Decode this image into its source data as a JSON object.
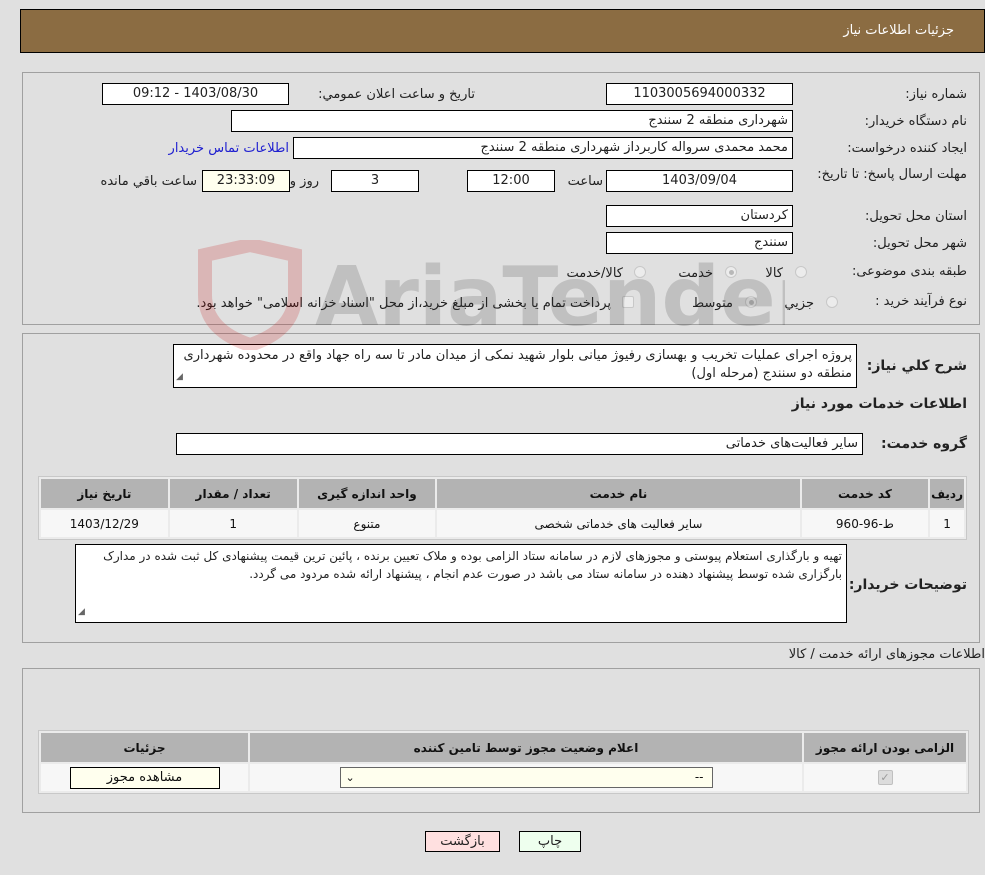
{
  "header": {
    "title": "جزئیات اطلاعات نیاز"
  },
  "form": {
    "need_number": {
      "label": "شماره نیاز:",
      "value": "1103005694000332"
    },
    "announce_datetime": {
      "label": "تاريخ و ساعت اعلان عمومي:",
      "value": "1403/08/30 - 09:12"
    },
    "buyer_org": {
      "label": "نام دستگاه خريدار:",
      "value": "شهرداری منطقه 2 سنندج"
    },
    "requester": {
      "label": "ايجاد کننده درخواست:",
      "value": "محمد محمدی سرواله کاربرداز شهرداری منطقه 2 سنندج"
    },
    "buyer_contact_link": "اطلاعات تماس خريدار",
    "deadline": {
      "label": "مهلت ارسال پاسخ: تا تاريخ:",
      "date": "1403/09/04",
      "time_label": "ساعت",
      "time": "12:00",
      "days": "3",
      "days_label": "روز و",
      "remaining": "23:33:09",
      "remaining_label": "ساعت باقي مانده"
    },
    "province": {
      "label": "استان محل تحويل:",
      "value": "کردستان"
    },
    "city": {
      "label": "شهر محل تحويل:",
      "value": "سنندج"
    },
    "category": {
      "label": "طبقه بندی موضوعی:",
      "options": [
        "کالا",
        "خدمت",
        "کالا/خدمت"
      ],
      "selected": "خدمت"
    },
    "purchase_type": {
      "label": "نوع فرآيند خريد :",
      "options": [
        "جزيي",
        "متوسط"
      ],
      "selected": "متوسط",
      "treasury_note": "پرداخت تمام يا بخشی از مبلغ خريد،از محل \"اسناد خزانه اسلامی\" خواهد بود."
    }
  },
  "description": {
    "label": "شرح کلي نياز:",
    "value": "پروژه اجرای عملیات تخریب و بهسازی رفیوژ میانی بلوار شهید نمکی از میدان مادر تا سه راه جهاد واقع در محدوده شهرداری منطقه دو سنندج (مرحله اول)"
  },
  "services": {
    "section_title": "اطلاعات خدمات مورد نياز",
    "group_label": "گروه خدمت:",
    "group_value": "ساير فعاليت‌های خدماتی",
    "table": {
      "headers": [
        "رديف",
        "کد خدمت",
        "نام خدمت",
        "واحد اندازه گيری",
        "تعداد / مقدار",
        "تاريخ نياز"
      ],
      "rows": [
        [
          "1",
          "ط-96-960",
          "ساير فعاليت های خدماتی شخصی",
          "متنوع",
          "1",
          "1403/12/29"
        ]
      ]
    }
  },
  "buyer_notes": {
    "label": "توضيحات خريدار:",
    "value": "تهيه و بارگذاری استعلام پيوستی و مجوزهای لازم در سامانه ستاد الزامی بوده و ملاک تعيين برنده ، پائين ترين قيمت پيشنهادی کل ثبت شده در مدارک بارگزاری شده توسط پيشنهاد دهنده در سامانه ستاد می باشد در صورت عدم انجام ، پيشنهاد ارائه شده مردود می گردد."
  },
  "permits": {
    "section_title": "اطلاعات مجوزهای ارائه خدمت / کالا",
    "headers": [
      "الزامی بودن ارائه مجوز",
      "اعلام وضعيت مجوز توسط تامين کننده",
      "جزئيات"
    ],
    "row": {
      "required_checked": true,
      "status_value": "--",
      "details_button": "مشاهده مجوز"
    }
  },
  "footer": {
    "print_button": "چاپ",
    "back_button": "بازگشت"
  },
  "watermark": {
    "text": "AriaTender.neT"
  }
}
